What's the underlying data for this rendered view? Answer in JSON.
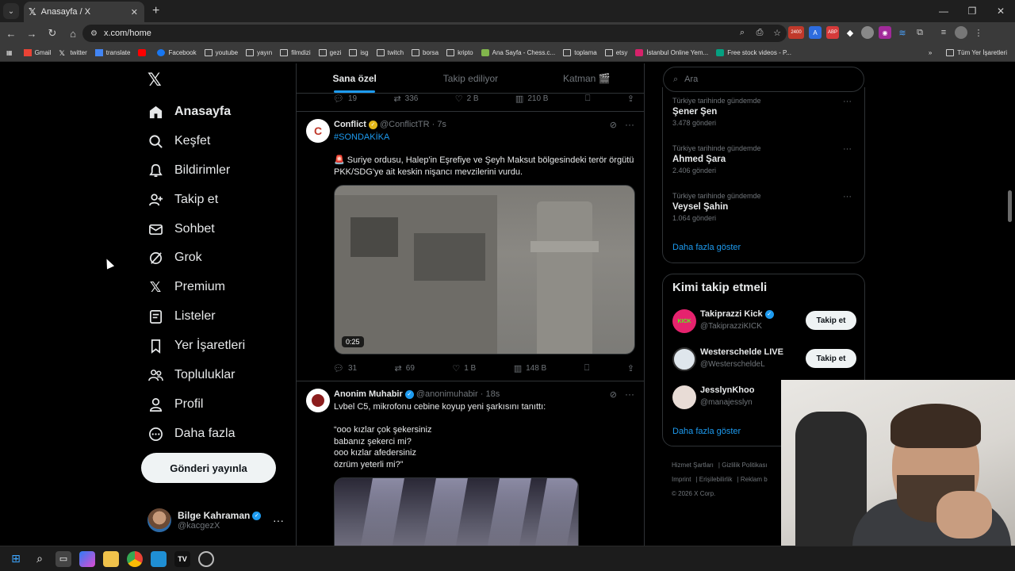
{
  "browser": {
    "tab_title": "Anasayfa / X",
    "url": "x.com/home",
    "bookmarks": [
      "Gmail",
      "twitter",
      "translate",
      "Facebook",
      "youtube",
      "yayın",
      "filmdizi",
      "gezi",
      "isg",
      "twitch",
      "borsa",
      "kripto",
      "Ana Sayfa - Chess.c...",
      "toplama",
      "etsy",
      "İstanbul Online Yem...",
      "Free stock videos - P..."
    ],
    "all_bookmarks": "Tüm Yer İşaretleri",
    "badge_count": "2400"
  },
  "nav": {
    "items": [
      {
        "label": "Anasayfa",
        "icon": "home-icon"
      },
      {
        "label": "Keşfet",
        "icon": "search-icon"
      },
      {
        "label": "Bildirimler",
        "icon": "bell-icon"
      },
      {
        "label": "Takip et",
        "icon": "add-user-icon"
      },
      {
        "label": "Sohbet",
        "icon": "mail-icon"
      },
      {
        "label": "Grok",
        "icon": "grok-icon"
      },
      {
        "label": "Premium",
        "icon": "x-icon"
      },
      {
        "label": "Listeler",
        "icon": "list-icon"
      },
      {
        "label": "Yer İşaretleri",
        "icon": "bookmark-icon"
      },
      {
        "label": "Topluluklar",
        "icon": "communities-icon"
      },
      {
        "label": "Profil",
        "icon": "profile-icon"
      },
      {
        "label": "Daha fazla",
        "icon": "more-icon"
      }
    ],
    "post_button": "Gönderi yayınla",
    "profile": {
      "name": "Bilge Kahraman",
      "handle": "@kacgezX"
    }
  },
  "feed": {
    "tabs": [
      "Sana özel",
      "Takip ediliyor",
      "Katman 🎬"
    ],
    "prev_actions": {
      "replies": "19",
      "reposts": "336",
      "likes": "2 B",
      "views": "210 B"
    },
    "tweets": [
      {
        "name": "Conflict",
        "handle": "@ConflictTR",
        "time": "· 7s",
        "hashtag": "#SONDAKİKA",
        "text": "🚨 Suriye ordusu, Halep'in Eşrefiye ve Şeyh Maksut bölgesindeki terör örgütü PKK/SDG'ye ait keskin nişancı mevzilerini vurdu.",
        "duration": "0:25",
        "replies": "31",
        "reposts": "69",
        "likes": "1 B",
        "views": "148 B"
      },
      {
        "name": "Anonim Muhabir",
        "handle": "@anonimuhabir",
        "time": "· 18s",
        "line1": "Lvbel C5, mikrofonu cebine koyup yeni şarkısını tanıttı:",
        "quote": [
          "“ooo kızlar çok şekersiniz",
          "babanız şekerci mi?",
          "ooo kızlar afedersiniz",
          "özrüm yeterli mi?”"
        ]
      }
    ]
  },
  "sidebar": {
    "search_placeholder": "Ara",
    "trends": [
      {
        "category": "Türkiye tarihinde gündemde",
        "name": "Şener Şen",
        "count": "3.478 gönderi"
      },
      {
        "category": "Türkiye tarihinde gündemde",
        "name": "Ahmed Şara",
        "count": "2.406 gönderi"
      },
      {
        "category": "Türkiye tarihinde gündemde",
        "name": "Veysel Şahin",
        "count": "1.064 gönderi"
      }
    ],
    "show_more": "Daha fazla göster",
    "who_to_follow_title": "Kimi takip etmeli",
    "suggestions": [
      {
        "name": "Takiprazzi Kick",
        "handle": "@TakiprazziKICK",
        "button": "Takip et"
      },
      {
        "name": "Westerschelde LIVE",
        "handle": "@WesterscheldeL",
        "button": "Takip et"
      },
      {
        "name": "JesslynKhoo",
        "handle": "@manajesslyn",
        "button": ""
      }
    ],
    "footer_links": [
      "Hizmet Şartları",
      "Gizlilik Politikası",
      "Imprint",
      "Erişilebilirlik",
      "Reklam b"
    ],
    "copyright": "© 2026 X Corp."
  },
  "colors": {
    "accent": "#1d9bf0",
    "background": "#000000",
    "border": "#2f3336",
    "muted": "#71767b",
    "gold_badge": "#e2b719"
  }
}
